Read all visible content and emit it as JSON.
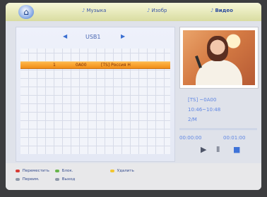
{
  "colors": {
    "red": "#d73b34",
    "green": "#68b54a",
    "yellow": "#f2c630",
    "blue": "#5f86e3",
    "highlight": "#f49a22"
  },
  "topbar": {
    "home_symbol": "⌂",
    "tabs": [
      {
        "label": "Музыка"
      },
      {
        "label": "Изобр"
      },
      {
        "label": "Видео"
      }
    ]
  },
  "browser": {
    "source": "USB1",
    "selected_row": {
      "index": "1",
      "code": "0A00",
      "title": "[TS] Россия Н"
    }
  },
  "playback": {
    "file_line": "[TS] ~0A00",
    "time_range": "10:46~10:48",
    "size": "2/M",
    "progress": 0.0,
    "time_current": "00:00:00",
    "time_total": "00:01:00"
  },
  "footer": {
    "legend_red": "Переместить",
    "legend_green": "Блок.",
    "legend_yellow": "Удалить",
    "legend_mode": "Переим.",
    "legend_exit": "Выход"
  }
}
